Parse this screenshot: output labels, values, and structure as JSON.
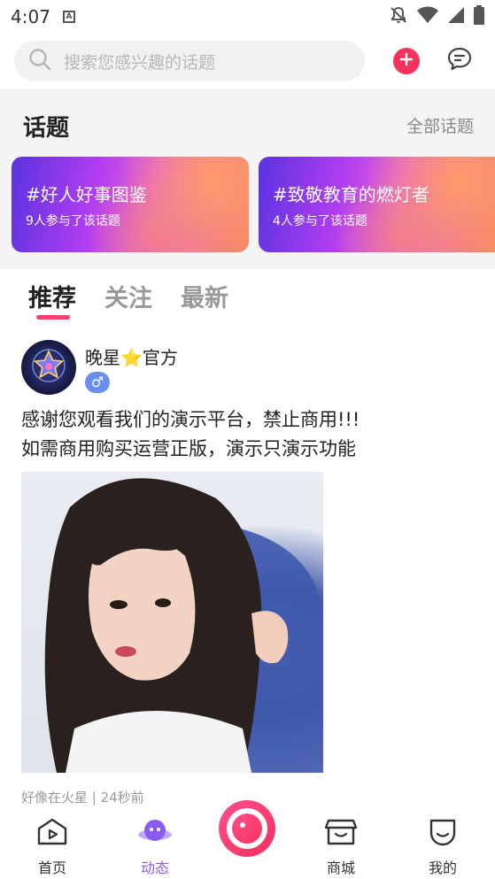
{
  "status_bar": {
    "time": "4:07",
    "notification_icon_letter": "A"
  },
  "search": {
    "placeholder": "搜索您感兴趣的话题"
  },
  "topics": {
    "title": "话题",
    "all_link": "全部话题",
    "cards": [
      {
        "name": "#好人好事图鉴",
        "count": "9人参与了该话题"
      },
      {
        "name": "#致敬教育的燃灯者",
        "count": "4人参与了该话题"
      }
    ]
  },
  "feed_tabs": [
    {
      "label": "推荐",
      "active": true
    },
    {
      "label": "关注",
      "active": false
    },
    {
      "label": "最新",
      "active": false
    }
  ],
  "post": {
    "username": "晚星⭐官方",
    "gender_symbol": "♂",
    "text_line1": "感谢您观看我们的演示平台，禁止商用!!!",
    "text_line2": "如需商用购买运营正版，演示只演示功能",
    "meta": "好像在火星 | 24秒前"
  },
  "bottom_nav": [
    {
      "label": "首页",
      "icon": "home-play-icon",
      "active": false
    },
    {
      "label": "动态",
      "icon": "planet-icon",
      "active": true
    },
    {
      "label": "商城",
      "icon": "store-icon",
      "active": false
    },
    {
      "label": "我的",
      "icon": "smile-icon",
      "active": false
    }
  ],
  "colors": {
    "accent_pink": "#f5325e",
    "active_purple": "#8a5cf0"
  }
}
